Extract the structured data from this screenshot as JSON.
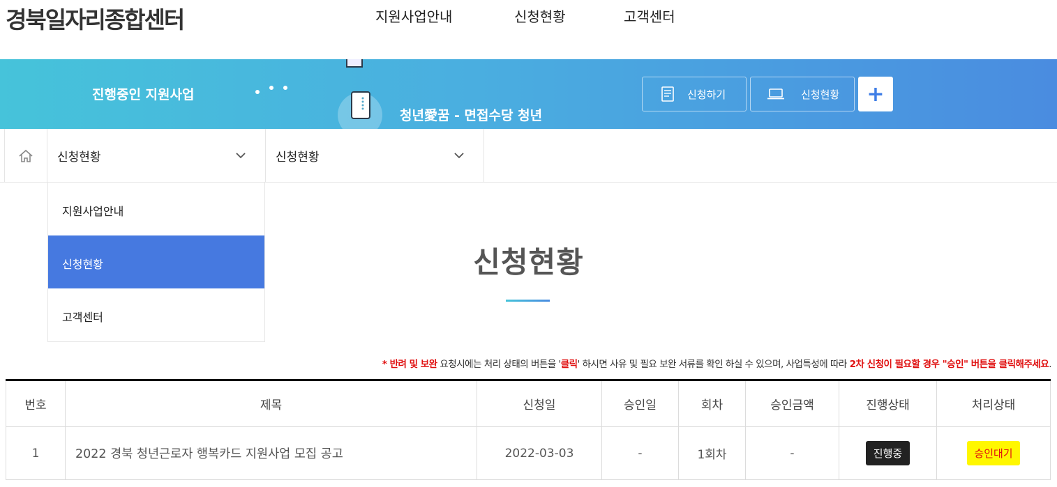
{
  "header": {
    "logo": "경북일자리종합센터",
    "nav": [
      "지원사업안내",
      "신청현황",
      "고객센터"
    ]
  },
  "banner": {
    "title": "진행중인 지원사업",
    "subtitle": "청년愛꿈 - 면접수당 청년",
    "apply_label": "신청하기",
    "status_label": "신청현황",
    "plus_label": "+"
  },
  "location": {
    "select1": "신청현황",
    "select2": "신청현황"
  },
  "dropdown": {
    "items": [
      "지원사업안내",
      "신청현황",
      "고객센터"
    ],
    "active": "신청현황"
  },
  "page": {
    "title": "신청현황"
  },
  "notice": {
    "star": "* ",
    "part1_red": "반려 및 보완",
    "part2": " 요청시에는 처리 상태의 버튼을 '",
    "part3_red": "클릭",
    "part4": "' 하시면 사유 및 필요 보완 서류를 확인 하실 수 있으며, 사업특성에 따라 ",
    "part5_red": "2차 신청이 필요할 경우 \"승인\" 버튼을 클릭해주세요",
    "part6": "."
  },
  "table": {
    "headers": [
      "번호",
      "제목",
      "신청일",
      "승인일",
      "회차",
      "승인금액",
      "진행상태",
      "처리상태"
    ],
    "rows": [
      {
        "no": "1",
        "title": "2022 경북 청년근로자 행복카드 지원사업 모집 공고",
        "applied": "2022-03-03",
        "approved": "-",
        "round": "1회차",
        "amount": "-",
        "progress": "진행중",
        "status": "승인대기"
      }
    ]
  },
  "colors": {
    "accent": "#4679e0",
    "banner_start": "#46c3da",
    "banner_end": "#4a8ce0",
    "notice_red": "#e01010",
    "status_yellow": "#fff700"
  }
}
